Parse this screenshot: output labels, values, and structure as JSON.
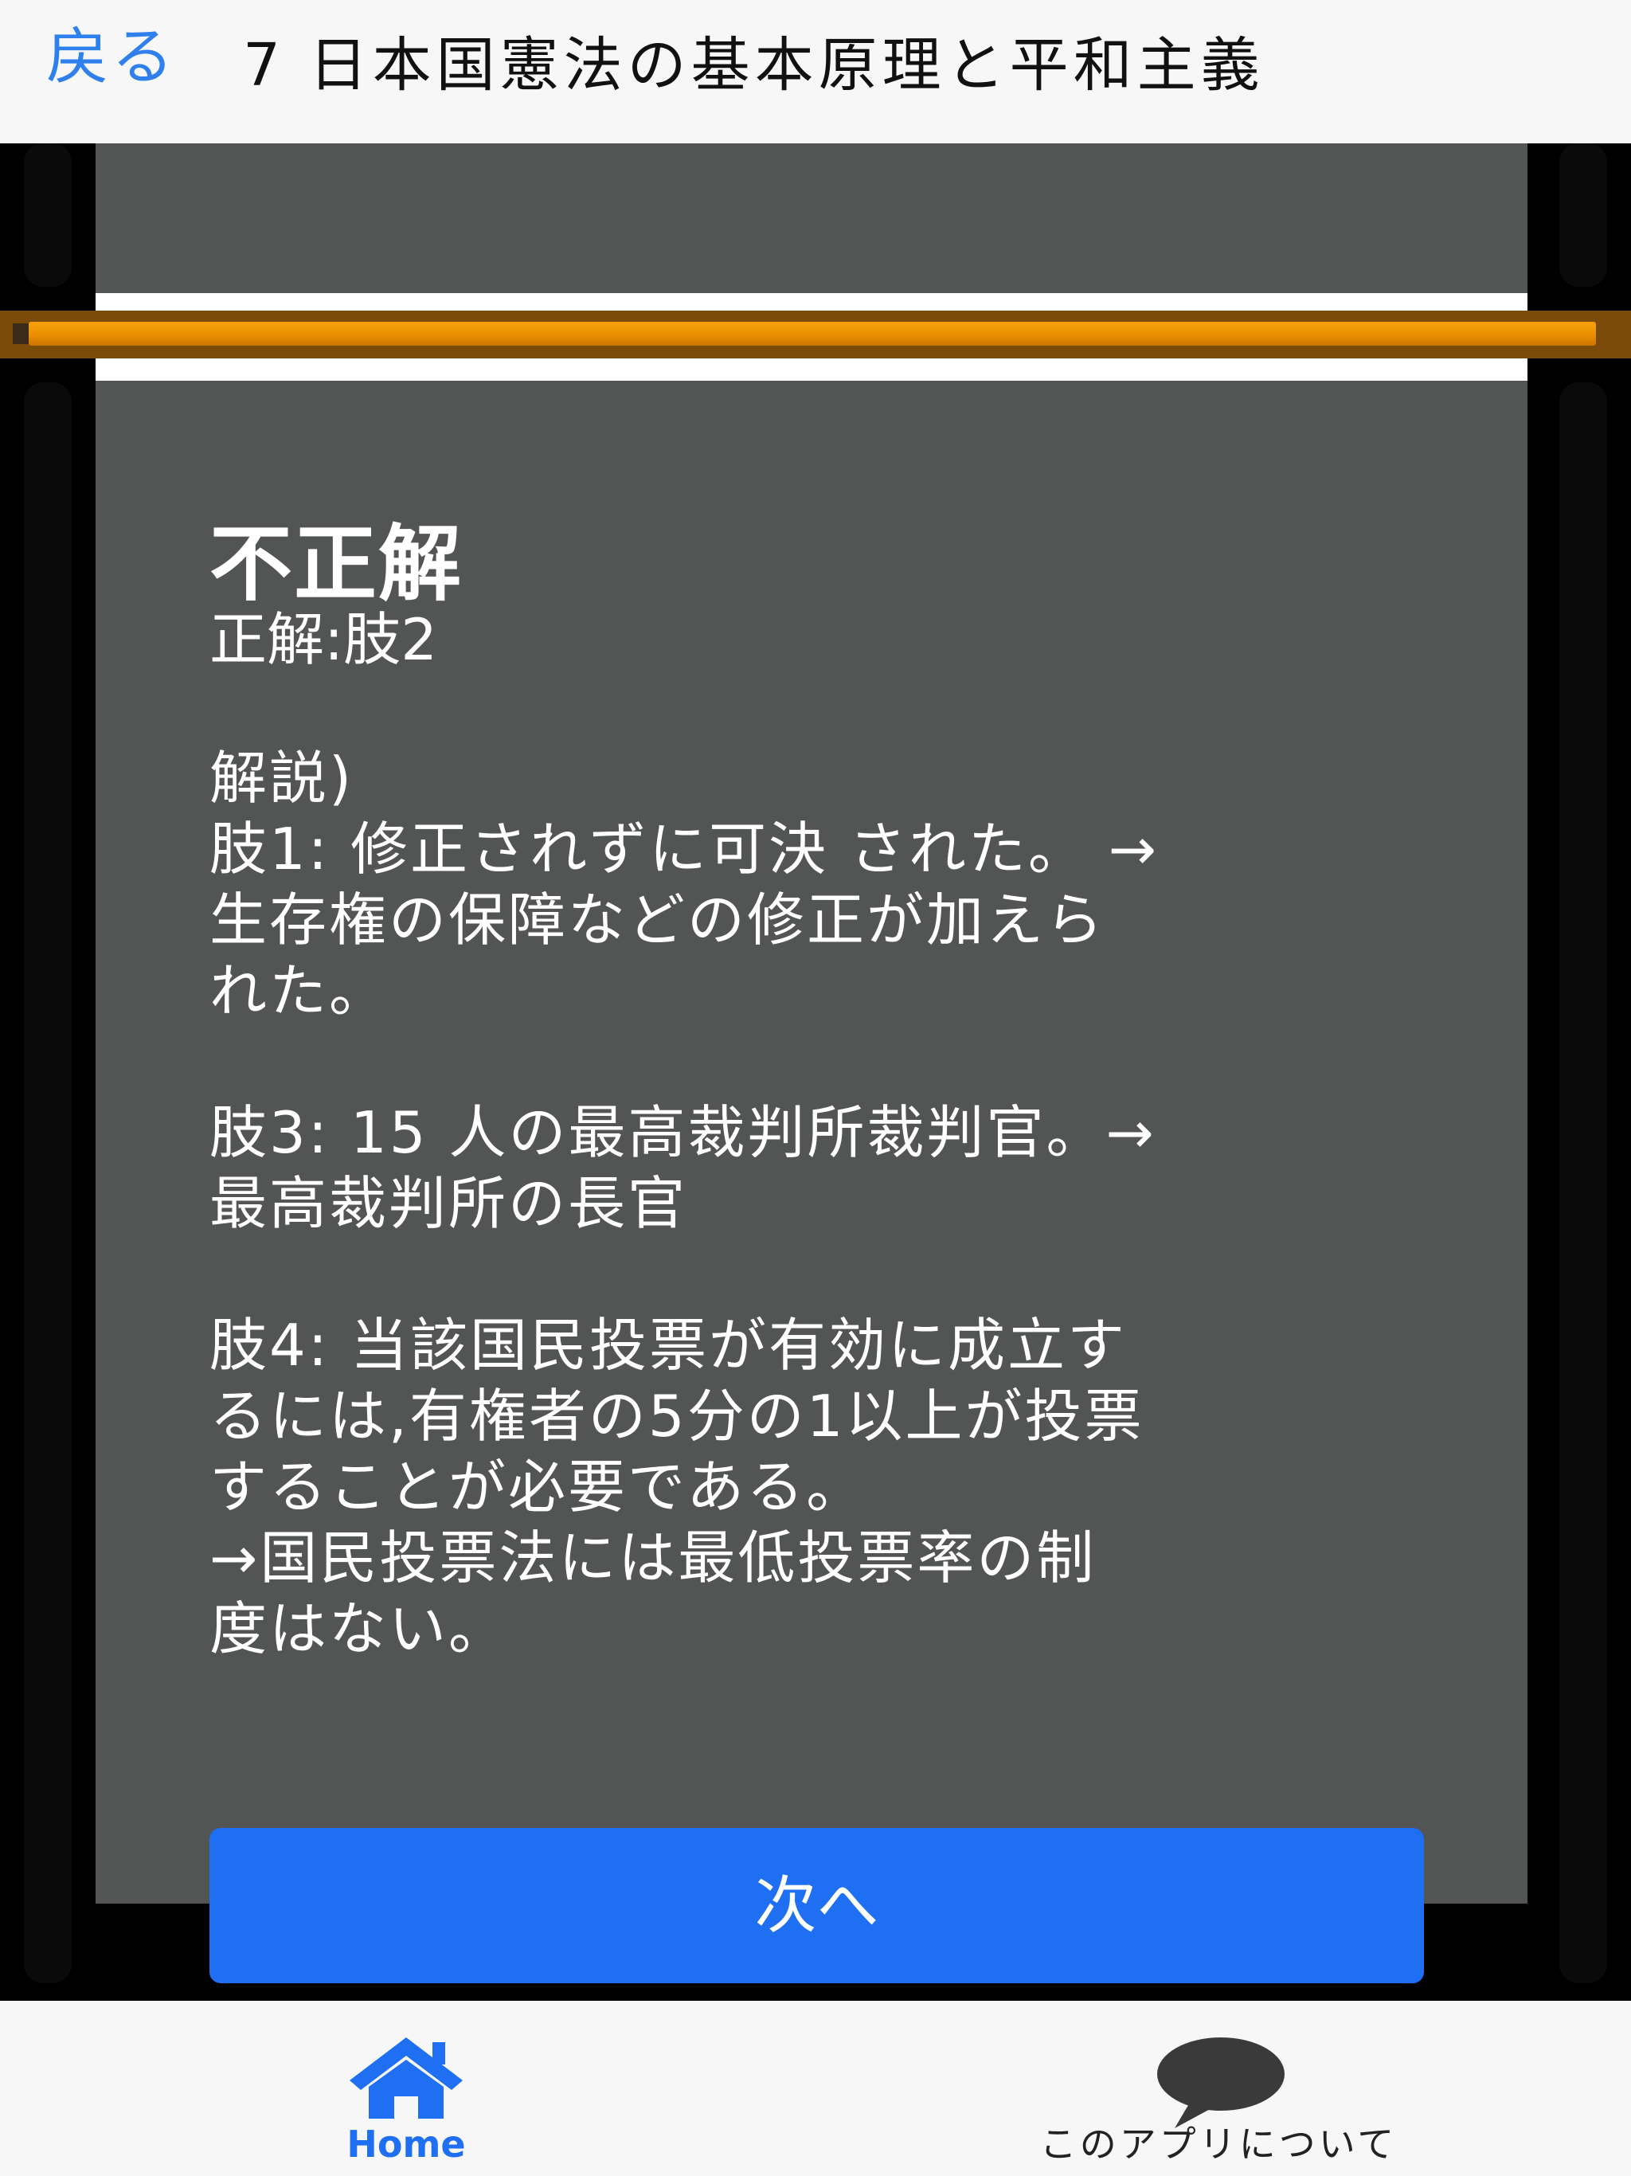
{
  "header": {
    "back_label": "戻る",
    "title": "7 日本国憲法の基本原理と平和主義"
  },
  "progress": {
    "fraction": 0.985
  },
  "result": {
    "heading": "不正解",
    "answer": "正解:肢2",
    "explanation": "解説)\n肢1: 修正されずに可決 された。 →\n生存権の保障などの修正が加えら\nれた。\n\n肢3: 15 人の最高裁判所裁判官。→\n最高裁判所の長官\n\n肢4: 当該国民投票が有効に成立す\nるには,有権者の5分の1以上が投票\nすることが必要である。\n→国民投票法には最低投票率の制\n度はない。"
  },
  "next_button": {
    "label": "次へ"
  },
  "tabbar": {
    "home_label": "Home",
    "home_icon": "home-icon",
    "about_label": "このアプリについて",
    "about_icon": "speech-bubble-icon"
  },
  "colors": {
    "accent": "#1e6ff2",
    "link": "#2f80ed",
    "card": "#535454",
    "progress": "#e88d00"
  }
}
